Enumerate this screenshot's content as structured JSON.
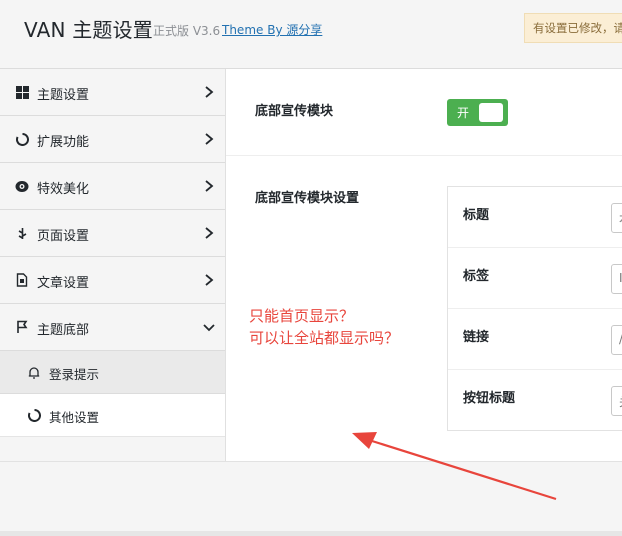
{
  "header": {
    "title": "VAN 主题设置",
    "version": "正式版 V3.6",
    "credit_link": "Theme By 源分享",
    "notice": "有设置已修改，请"
  },
  "sidebar": {
    "items": [
      {
        "label": "主题设置",
        "icon": "grid-icon"
      },
      {
        "label": "扩展功能",
        "icon": "circle-icon"
      },
      {
        "label": "特效美化",
        "icon": "eye-icon"
      },
      {
        "label": "页面设置",
        "icon": "leaf-icon"
      },
      {
        "label": "文章设置",
        "icon": "document-icon"
      },
      {
        "label": "主题底部",
        "icon": "flag-icon"
      }
    ],
    "sub_items": [
      {
        "label": "登录提示",
        "icon": "bell-icon"
      },
      {
        "label": "其他设置",
        "icon": "circle-icon"
      }
    ]
  },
  "main": {
    "promo_module_label": "底部宣传模块",
    "toggle_text": "开",
    "promo_settings_label": "底部宣传模块设置",
    "fields": [
      {
        "label": "标题",
        "value": "本"
      },
      {
        "label": "标签",
        "value": "It"
      },
      {
        "label": "链接",
        "value": "/"
      },
      {
        "label": "按钮标题",
        "value": "关"
      }
    ]
  },
  "annotation": {
    "line1": "只能首页显示？",
    "line2": "可以让全站都显示吗？",
    "color": "#e8453c"
  },
  "colors": {
    "toggle_on": "#4caf50",
    "link": "#2271b1",
    "notice_bg": "#fbeed5"
  }
}
